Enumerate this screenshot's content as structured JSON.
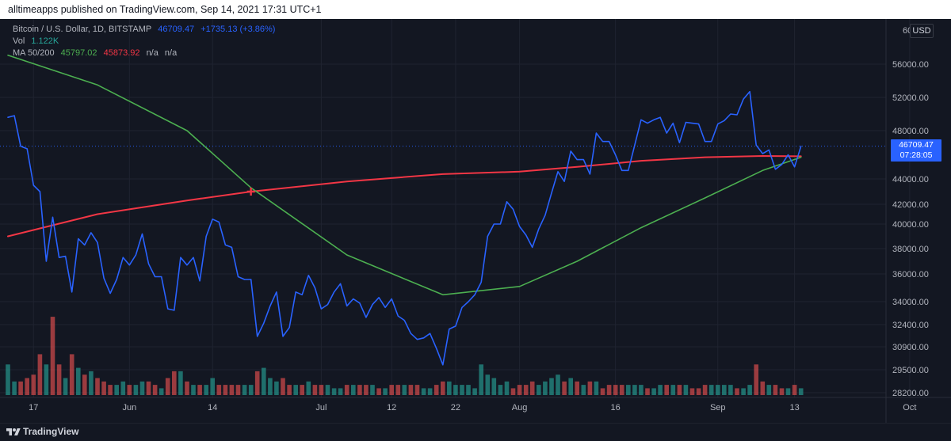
{
  "publish_line": "alltimeapps published on TradingView.com, Sep 14, 2021 17:31 UTC+1",
  "legend": {
    "symbol": "Bitcoin / U.S. Dollar, 1D, BITSTAMP",
    "price": "46709.47",
    "change": "+1735.13 (+3.86%)",
    "vol_label": "Vol",
    "vol_value": "1.122K",
    "ma_label": "MA 50/200",
    "ma50": "45797.02",
    "ma200": "45873.92",
    "na1": "n/a",
    "na2": "n/a"
  },
  "currency": "USD",
  "price_label": {
    "price": "46709.47",
    "countdown": "07:28:05"
  },
  "footer": {
    "brand": "TradingView"
  },
  "colors": {
    "background": "#131722",
    "price_line": "#2962ff",
    "ma50": "#4caf50",
    "ma200": "#f23645",
    "volume_up": "#26a69a",
    "volume_down": "#ef5350"
  },
  "chart_data": {
    "type": "line",
    "y_ticks": [
      "56000.00",
      "52000.00",
      "48000.00",
      "44000.00",
      "42000.00",
      "40000.00",
      "38000.00",
      "36000.00",
      "34000.00",
      "32400.00",
      "30900.00",
      "29500.00",
      "28200.00"
    ],
    "y_top_tick_partial": "60",
    "x_ticks": [
      "17",
      "Jun",
      "14",
      "Jul",
      "12",
      "22",
      "Aug",
      "16",
      "Sep",
      "13",
      "Oct"
    ],
    "series": [
      {
        "name": "Bitcoin / U.S. Dollar",
        "dates": [
          "05-13",
          "05-14",
          "05-15",
          "05-16",
          "05-17",
          "05-18",
          "05-19",
          "05-20",
          "05-21",
          "05-22",
          "05-23",
          "05-24",
          "05-25",
          "05-26",
          "05-27",
          "05-28",
          "05-29",
          "05-30",
          "05-31",
          "06-01",
          "06-02",
          "06-03",
          "06-04",
          "06-05",
          "06-06",
          "06-07",
          "06-08",
          "06-09",
          "06-10",
          "06-11",
          "06-12",
          "06-13",
          "06-14",
          "06-15",
          "06-16",
          "06-17",
          "06-18",
          "06-19",
          "06-20",
          "06-21",
          "06-22",
          "06-23",
          "06-24",
          "06-25",
          "06-26",
          "06-27",
          "06-28",
          "06-29",
          "06-30",
          "07-01",
          "07-02",
          "07-03",
          "07-04",
          "07-05",
          "07-06",
          "07-07",
          "07-08",
          "07-09",
          "07-10",
          "07-11",
          "07-12",
          "07-13",
          "07-14",
          "07-15",
          "07-16",
          "07-17",
          "07-18",
          "07-19",
          "07-20",
          "07-21",
          "07-22",
          "07-23",
          "07-24",
          "07-25",
          "07-26",
          "07-27",
          "07-28",
          "07-29",
          "07-30",
          "07-31",
          "08-01",
          "08-02",
          "08-03",
          "08-04",
          "08-05",
          "08-06",
          "08-07",
          "08-08",
          "08-09",
          "08-10",
          "08-11",
          "08-12",
          "08-13",
          "08-14",
          "08-15",
          "08-16",
          "08-17",
          "08-18",
          "08-19",
          "08-20",
          "08-21",
          "08-22",
          "08-23",
          "08-24",
          "08-25",
          "08-26",
          "08-27",
          "08-28",
          "08-29",
          "08-30",
          "08-31",
          "09-01",
          "09-02",
          "09-03",
          "09-04",
          "09-05",
          "09-06",
          "09-07",
          "09-08",
          "09-09",
          "09-10",
          "09-11",
          "09-12",
          "09-13",
          "09-14"
        ],
        "values": [
          49600,
          49800,
          46700,
          46500,
          43500,
          43000,
          37000,
          40700,
          37300,
          37400,
          34700,
          38800,
          38300,
          39300,
          38500,
          35700,
          34600,
          35600,
          37300,
          36700,
          37500,
          39200,
          36800,
          35800,
          35800,
          33500,
          33400,
          37300,
          36700,
          37300,
          35500,
          39000,
          40500,
          40200,
          38300,
          38100,
          35800,
          35600,
          35600,
          31600,
          32500,
          33700,
          34700,
          31600,
          32200,
          34700,
          34500,
          35900,
          35000,
          33500,
          33800,
          34700,
          35300,
          33700,
          34200,
          33900,
          32900,
          33800,
          34300,
          33600,
          34200,
          33000,
          32700,
          31800,
          31400,
          31500,
          31800,
          30800,
          29800,
          32100,
          32300,
          33600,
          34000,
          34500,
          35400,
          39000,
          40000,
          40000,
          42200,
          41500,
          39800,
          39100,
          38100,
          39600,
          40900,
          42900,
          44600,
          43800,
          46300,
          45600,
          45600,
          44400,
          47800,
          47100,
          47100,
          46000,
          44700,
          44700,
          46800,
          49300,
          48900,
          49300,
          49600,
          47800,
          48900,
          47000,
          49000,
          48900,
          48800,
          47100,
          47100,
          48800,
          49200,
          50000,
          49900,
          51800,
          52700,
          46800,
          46100,
          46400,
          44800,
          45200,
          46000,
          45000,
          46709.47
        ]
      },
      {
        "name": "MA 50",
        "dates": [
          "05-13",
          "05-27",
          "06-10",
          "06-20",
          "07-05",
          "07-20",
          "08-01",
          "08-10",
          "08-20",
          "08-30",
          "09-08",
          "09-14"
        ],
        "values": [
          57000,
          53500,
          48000,
          43300,
          37500,
          34500,
          35100,
          37000,
          39700,
          42500,
          44700,
          45797.02
        ]
      },
      {
        "name": "MA 200",
        "dates": [
          "05-13",
          "05-27",
          "06-10",
          "06-20",
          "07-05",
          "07-20",
          "08-01",
          "08-10",
          "08-20",
          "08-30",
          "09-08",
          "09-14"
        ],
        "values": [
          39000,
          41000,
          42300,
          43000,
          43800,
          44400,
          44600,
          45000,
          45500,
          45800,
          45900,
          45873.92
        ]
      }
    ],
    "cross_marker": {
      "date": "06-20",
      "value": 43000
    },
    "volume": [
      {
        "d": "05-13",
        "v": 9,
        "up": true
      },
      {
        "d": "05-14",
        "v": 4,
        "up": true
      },
      {
        "d": "05-15",
        "v": 4,
        "up": false
      },
      {
        "d": "05-16",
        "v": 5,
        "up": false
      },
      {
        "d": "05-17",
        "v": 6,
        "up": false
      },
      {
        "d": "05-18",
        "v": 12,
        "up": false
      },
      {
        "d": "05-19",
        "v": 9,
        "up": true
      },
      {
        "d": "05-20",
        "v": 23,
        "up": false
      },
      {
        "d": "05-21",
        "v": 9,
        "up": false
      },
      {
        "d": "05-22",
        "v": 5,
        "up": true
      },
      {
        "d": "05-23",
        "v": 12,
        "up": false
      },
      {
        "d": "05-24",
        "v": 8,
        "up": true
      },
      {
        "d": "05-25",
        "v": 6,
        "up": false
      },
      {
        "d": "05-26",
        "v": 7,
        "up": true
      },
      {
        "d": "05-27",
        "v": 5,
        "up": false
      },
      {
        "d": "05-28",
        "v": 4,
        "up": false
      },
      {
        "d": "05-29",
        "v": 3,
        "up": false
      },
      {
        "d": "05-30",
        "v": 3,
        "up": true
      },
      {
        "d": "05-31",
        "v": 4,
        "up": true
      },
      {
        "d": "06-01",
        "v": 3,
        "up": false
      },
      {
        "d": "06-02",
        "v": 3,
        "up": true
      },
      {
        "d": "06-03",
        "v": 4,
        "up": true
      },
      {
        "d": "06-04",
        "v": 4,
        "up": false
      },
      {
        "d": "06-05",
        "v": 3,
        "up": false
      },
      {
        "d": "06-06",
        "v": 2,
        "up": true
      },
      {
        "d": "06-07",
        "v": 5,
        "up": false
      },
      {
        "d": "06-08",
        "v": 7,
        "up": false
      },
      {
        "d": "06-09",
        "v": 7,
        "up": true
      },
      {
        "d": "06-10",
        "v": 4,
        "up": false
      },
      {
        "d": "06-11",
        "v": 3,
        "up": true
      },
      {
        "d": "06-12",
        "v": 3,
        "up": false
      },
      {
        "d": "06-13",
        "v": 3,
        "up": true
      },
      {
        "d": "06-14",
        "v": 5,
        "up": true
      },
      {
        "d": "06-15",
        "v": 3,
        "up": false
      },
      {
        "d": "06-16",
        "v": 3,
        "up": false
      },
      {
        "d": "06-17",
        "v": 3,
        "up": false
      },
      {
        "d": "06-18",
        "v": 3,
        "up": false
      },
      {
        "d": "06-19",
        "v": 3,
        "up": true
      },
      {
        "d": "06-20",
        "v": 3,
        "up": true
      },
      {
        "d": "06-21",
        "v": 7,
        "up": false
      },
      {
        "d": "06-22",
        "v": 8,
        "up": true
      },
      {
        "d": "06-23",
        "v": 5,
        "up": true
      },
      {
        "d": "06-24",
        "v": 4,
        "up": true
      },
      {
        "d": "06-25",
        "v": 5,
        "up": false
      },
      {
        "d": "06-26",
        "v": 3,
        "up": false
      },
      {
        "d": "06-27",
        "v": 3,
        "up": true
      },
      {
        "d": "06-28",
        "v": 3,
        "up": false
      },
      {
        "d": "06-29",
        "v": 4,
        "up": true
      },
      {
        "d": "06-30",
        "v": 3,
        "up": false
      },
      {
        "d": "07-01",
        "v": 3,
        "up": false
      },
      {
        "d": "07-02",
        "v": 3,
        "up": true
      },
      {
        "d": "07-03",
        "v": 2,
        "up": true
      },
      {
        "d": "07-04",
        "v": 2,
        "up": true
      },
      {
        "d": "07-05",
        "v": 3,
        "up": false
      },
      {
        "d": "07-06",
        "v": 3,
        "up": true
      },
      {
        "d": "07-07",
        "v": 3,
        "up": false
      },
      {
        "d": "07-08",
        "v": 3,
        "up": false
      },
      {
        "d": "07-09",
        "v": 3,
        "up": true
      },
      {
        "d": "07-10",
        "v": 2,
        "up": false
      },
      {
        "d": "07-11",
        "v": 2,
        "up": true
      },
      {
        "d": "07-12",
        "v": 3,
        "up": false
      },
      {
        "d": "07-13",
        "v": 3,
        "up": false
      },
      {
        "d": "07-14",
        "v": 3,
        "up": true
      },
      {
        "d": "07-15",
        "v": 3,
        "up": false
      },
      {
        "d": "07-16",
        "v": 3,
        "up": false
      },
      {
        "d": "07-17",
        "v": 2,
        "up": true
      },
      {
        "d": "07-18",
        "v": 2,
        "up": true
      },
      {
        "d": "07-19",
        "v": 3,
        "up": false
      },
      {
        "d": "07-20",
        "v": 4,
        "up": false
      },
      {
        "d": "07-21",
        "v": 4,
        "up": true
      },
      {
        "d": "07-22",
        "v": 3,
        "up": true
      },
      {
        "d": "07-23",
        "v": 3,
        "up": true
      },
      {
        "d": "07-24",
        "v": 3,
        "up": true
      },
      {
        "d": "07-25",
        "v": 2,
        "up": true
      },
      {
        "d": "07-26",
        "v": 9,
        "up": true
      },
      {
        "d": "07-27",
        "v": 6,
        "up": true
      },
      {
        "d": "07-28",
        "v": 5,
        "up": true
      },
      {
        "d": "07-29",
        "v": 3,
        "up": true
      },
      {
        "d": "07-30",
        "v": 4,
        "up": true
      },
      {
        "d": "07-31",
        "v": 2,
        "up": false
      },
      {
        "d": "08-01",
        "v": 3,
        "up": false
      },
      {
        "d": "08-02",
        "v": 3,
        "up": false
      },
      {
        "d": "08-03",
        "v": 4,
        "up": false
      },
      {
        "d": "08-04",
        "v": 3,
        "up": true
      },
      {
        "d": "08-05",
        "v": 4,
        "up": true
      },
      {
        "d": "08-06",
        "v": 5,
        "up": true
      },
      {
        "d": "08-07",
        "v": 6,
        "up": true
      },
      {
        "d": "08-08",
        "v": 4,
        "up": false
      },
      {
        "d": "08-09",
        "v": 5,
        "up": true
      },
      {
        "d": "08-10",
        "v": 4,
        "up": false
      },
      {
        "d": "08-11",
        "v": 3,
        "up": true
      },
      {
        "d": "08-12",
        "v": 4,
        "up": false
      },
      {
        "d": "08-13",
        "v": 4,
        "up": true
      },
      {
        "d": "08-14",
        "v": 2,
        "up": false
      },
      {
        "d": "08-15",
        "v": 3,
        "up": false
      },
      {
        "d": "08-16",
        "v": 3,
        "up": false
      },
      {
        "d": "08-17",
        "v": 3,
        "up": false
      },
      {
        "d": "08-18",
        "v": 3,
        "up": true
      },
      {
        "d": "08-19",
        "v": 3,
        "up": true
      },
      {
        "d": "08-20",
        "v": 3,
        "up": true
      },
      {
        "d": "08-21",
        "v": 2,
        "up": false
      },
      {
        "d": "08-22",
        "v": 2,
        "up": true
      },
      {
        "d": "08-23",
        "v": 3,
        "up": true
      },
      {
        "d": "08-24",
        "v": 3,
        "up": false
      },
      {
        "d": "08-25",
        "v": 3,
        "up": true
      },
      {
        "d": "08-26",
        "v": 3,
        "up": false
      },
      {
        "d": "08-27",
        "v": 3,
        "up": true
      },
      {
        "d": "08-28",
        "v": 2,
        "up": false
      },
      {
        "d": "08-29",
        "v": 2,
        "up": false
      },
      {
        "d": "08-30",
        "v": 3,
        "up": false
      },
      {
        "d": "08-31",
        "v": 3,
        "up": true
      },
      {
        "d": "09-01",
        "v": 3,
        "up": true
      },
      {
        "d": "09-02",
        "v": 3,
        "up": true
      },
      {
        "d": "09-03",
        "v": 3,
        "up": true
      },
      {
        "d": "09-04",
        "v": 2,
        "up": false
      },
      {
        "d": "09-05",
        "v": 2,
        "up": true
      },
      {
        "d": "09-06",
        "v": 3,
        "up": true
      },
      {
        "d": "09-07",
        "v": 9,
        "up": false
      },
      {
        "d": "09-08",
        "v": 4,
        "up": false
      },
      {
        "d": "09-09",
        "v": 3,
        "up": true
      },
      {
        "d": "09-10",
        "v": 3,
        "up": false
      },
      {
        "d": "09-11",
        "v": 2,
        "up": false
      },
      {
        "d": "09-12",
        "v": 2,
        "up": true
      },
      {
        "d": "09-13",
        "v": 3,
        "up": false
      },
      {
        "d": "09-14",
        "v": 2,
        "up": true
      }
    ]
  }
}
